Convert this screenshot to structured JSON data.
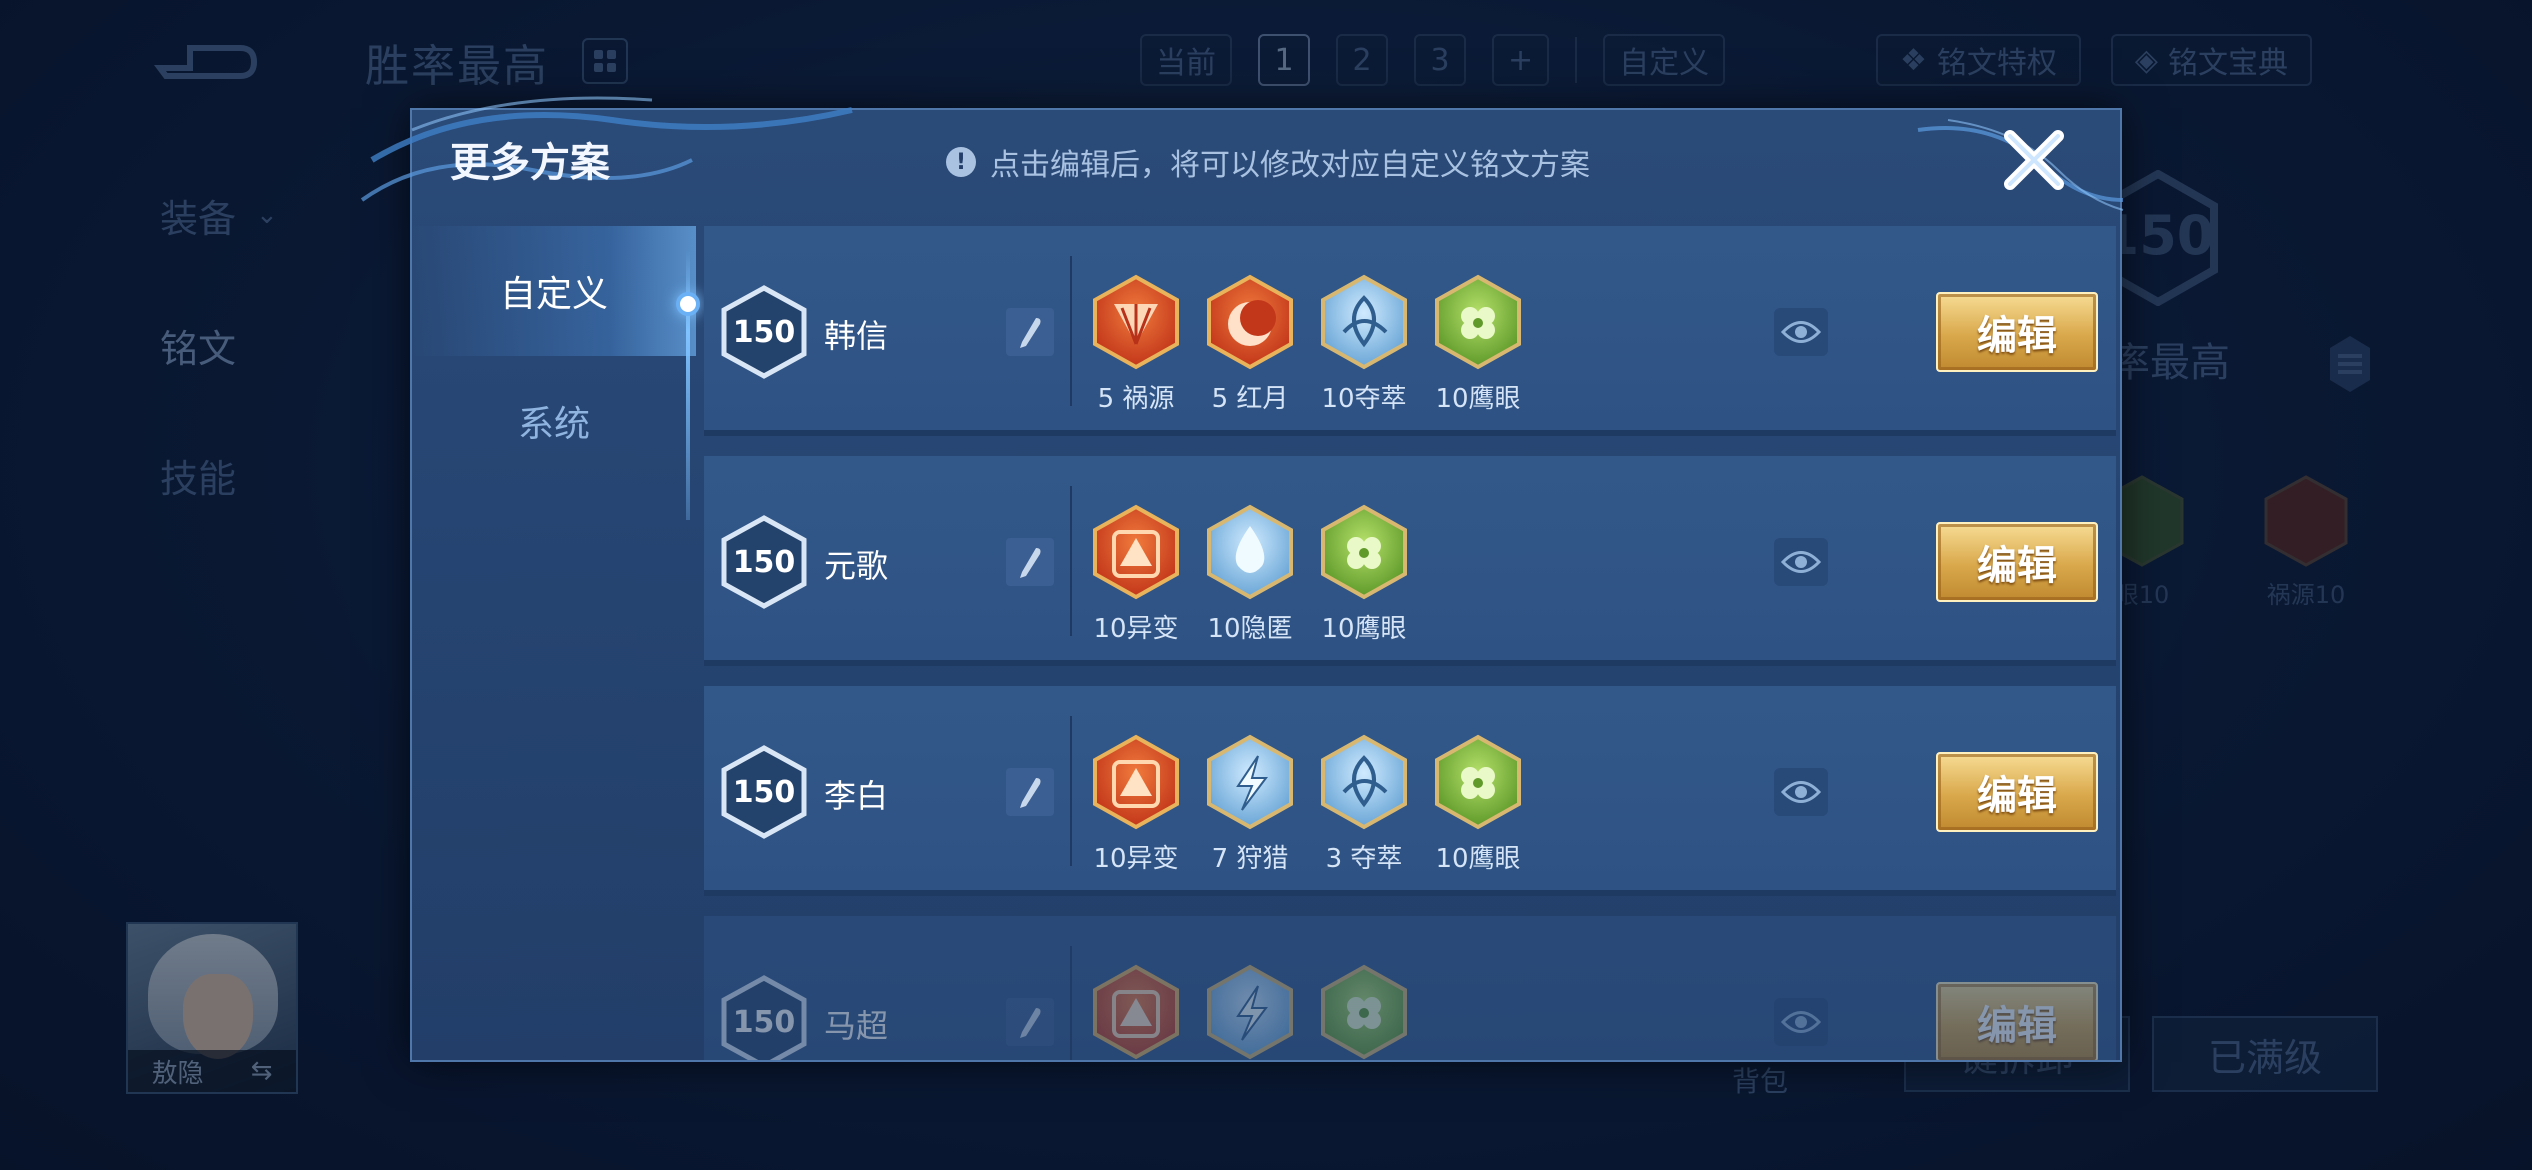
{
  "background": {
    "title": "胜率最高",
    "top_tabs": [
      "当前",
      "1",
      "2",
      "3",
      "+"
    ],
    "active_top_tab": "1",
    "custom_label": "自定义",
    "rune_privilege": "铭文特权",
    "rune_codex": "铭文宝典",
    "nav": [
      {
        "label": "装备"
      },
      {
        "label": "铭文"
      },
      {
        "label": "技能"
      }
    ],
    "hero_name": "敖隐",
    "right_level": "150",
    "right_title": "率最高",
    "right_runes": [
      {
        "label": "眼10"
      },
      {
        "label": "祸源10"
      }
    ],
    "bag_label": "背包",
    "dismantle_button": "键拆卸",
    "maxed_button": "已满级"
  },
  "modal": {
    "title": "更多方案",
    "tip": "点击编辑后，将可以修改对应自定义铭文方案",
    "tabs": [
      {
        "label": "自定义",
        "active": true
      },
      {
        "label": "系统",
        "active": false
      }
    ],
    "edit_label": "编辑",
    "schemes": [
      {
        "level": "150",
        "hero": "韩信",
        "runes": [
          {
            "label": "5 祸源",
            "color": "red",
            "icon": "fan-rune-icon"
          },
          {
            "label": "5 红月",
            "color": "red",
            "icon": "moon-rune-icon"
          },
          {
            "label": "10夺萃",
            "color": "blue",
            "icon": "knot-rune-icon"
          },
          {
            "label": "10鹰眼",
            "color": "green",
            "icon": "clover-rune-icon"
          }
        ]
      },
      {
        "level": "150",
        "hero": "元歌",
        "runes": [
          {
            "label": "10异变",
            "color": "red",
            "icon": "arrow-rune-icon"
          },
          {
            "label": "10隐匿",
            "color": "blue",
            "icon": "drop-rune-icon"
          },
          {
            "label": "10鹰眼",
            "color": "green",
            "icon": "clover-rune-icon"
          }
        ]
      },
      {
        "level": "150",
        "hero": "李白",
        "runes": [
          {
            "label": "10异变",
            "color": "red",
            "icon": "arrow-rune-icon"
          },
          {
            "label": "7 狩猎",
            "color": "blue",
            "icon": "lightning-rune-icon"
          },
          {
            "label": "3 夺萃",
            "color": "blue",
            "icon": "knot-rune-icon"
          },
          {
            "label": "10鹰眼",
            "color": "green",
            "icon": "clover-rune-icon"
          }
        ]
      },
      {
        "level": "150",
        "hero": "马超",
        "runes": [
          {
            "label": "",
            "color": "red",
            "icon": "arrow-rune-icon"
          },
          {
            "label": "",
            "color": "blue",
            "icon": "lightning-rune-icon"
          },
          {
            "label": "",
            "color": "green",
            "icon": "clover-rune-icon"
          }
        ]
      }
    ]
  },
  "colors": {
    "rune_red": "#d8461e",
    "rune_blue": "#8fc6ec",
    "rune_green": "#7fbf3a",
    "gold": "#e1b358"
  }
}
